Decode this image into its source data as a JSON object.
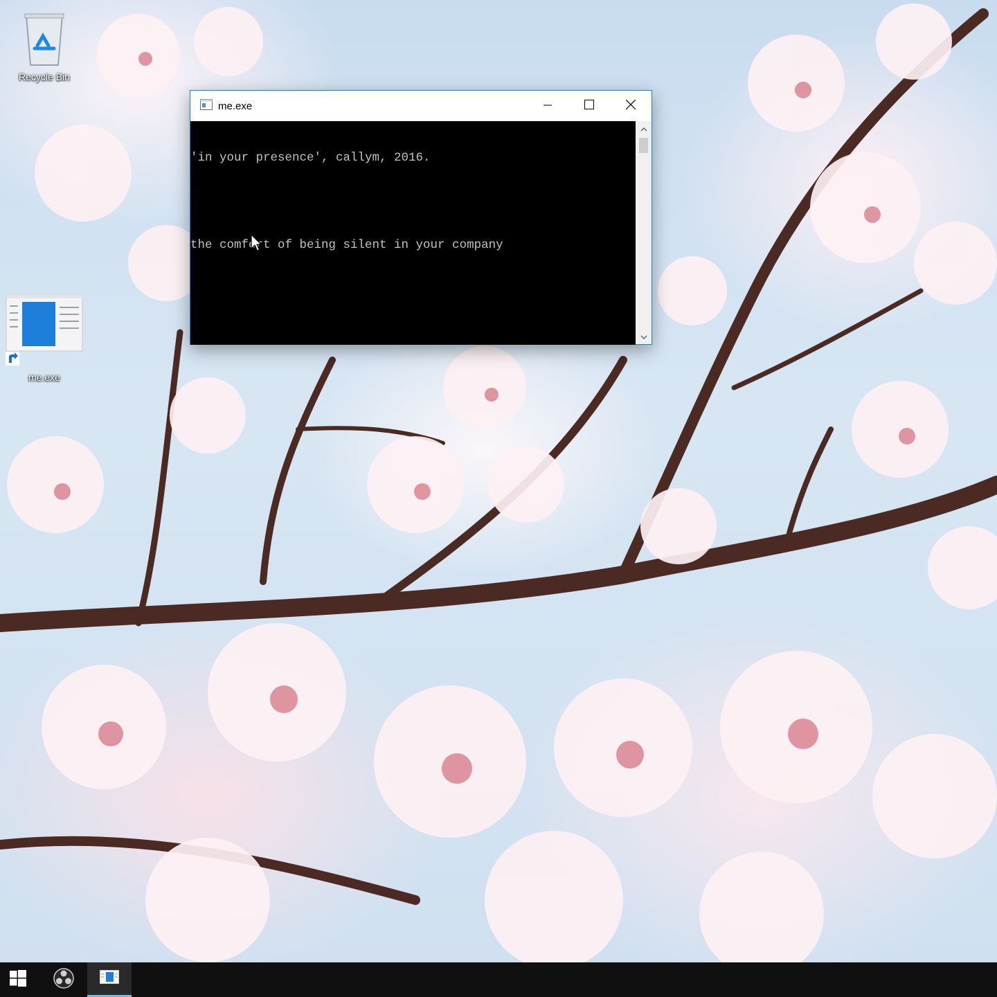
{
  "desktop": {
    "icons": [
      {
        "label": "Recycle Bin"
      },
      {
        "label": "me.exe"
      }
    ]
  },
  "window": {
    "title": "me.exe",
    "console_lines": [
      "'in your presence', callym, 2016.",
      "",
      "the comfort of being silent in your company"
    ]
  },
  "colors": {
    "accent": "#1883d7",
    "console_bg": "#000000",
    "console_fg": "#c0c0c0",
    "taskbar": "#101010"
  },
  "icons": [
    "recycle-bin-icon",
    "app-shortcut-icon",
    "minimize-icon",
    "maximize-icon",
    "close-icon",
    "windows-start-icon",
    "obs-icon",
    "taskbar-app-icon",
    "mouse-cursor-icon"
  ]
}
